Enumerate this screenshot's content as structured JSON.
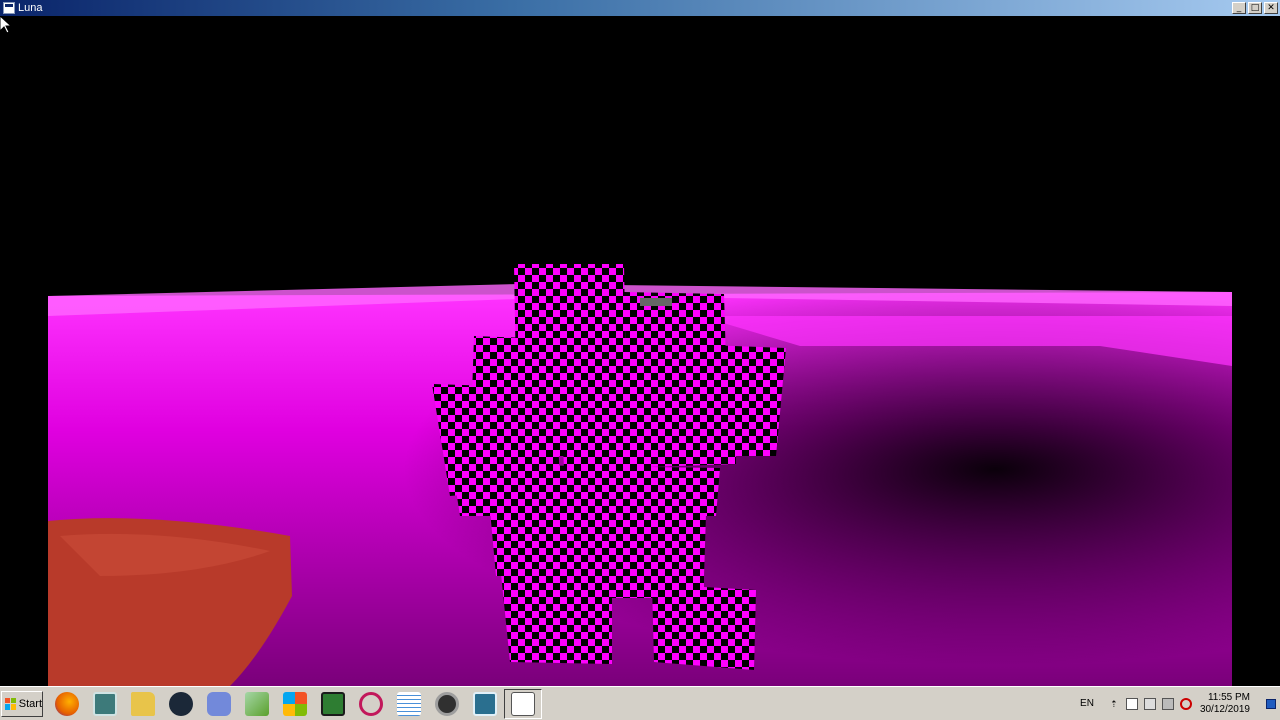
{
  "window": {
    "title": "Luna",
    "controls": {
      "minimize": "_",
      "maximize": "□",
      "close": "✕"
    }
  },
  "scene": {
    "description_colors": {
      "ground": "#ff00ff",
      "sky": "#000000",
      "object": "#b83a2a"
    }
  },
  "taskbar": {
    "start_label": "Start",
    "quick_launch": [
      {
        "name": "firefox-icon",
        "color": "#e66000"
      },
      {
        "name": "window-app-icon",
        "color": "#3d7a7a"
      },
      {
        "name": "folder-icon",
        "color": "#e8c44a"
      },
      {
        "name": "steam-icon",
        "color": "#1b2838"
      },
      {
        "name": "discord-icon",
        "color": "#7289da"
      },
      {
        "name": "editor-icon",
        "color": "#5aa02c"
      },
      {
        "name": "windows-flag-icon",
        "color": "#f35325"
      },
      {
        "name": "terminal-icon",
        "color": "#2e7d32"
      },
      {
        "name": "search-app-icon",
        "color": "#c2185b"
      },
      {
        "name": "notes-icon",
        "color": "#4a90d9"
      },
      {
        "name": "obs-icon",
        "color": "#303030"
      },
      {
        "name": "window-app-2-icon",
        "color": "#2a6f8f"
      },
      {
        "name": "calculator-icon",
        "color": "#ffffff"
      }
    ],
    "tray": {
      "language": "EN",
      "time": "11:55 PM",
      "date": "30/12/2019"
    }
  }
}
